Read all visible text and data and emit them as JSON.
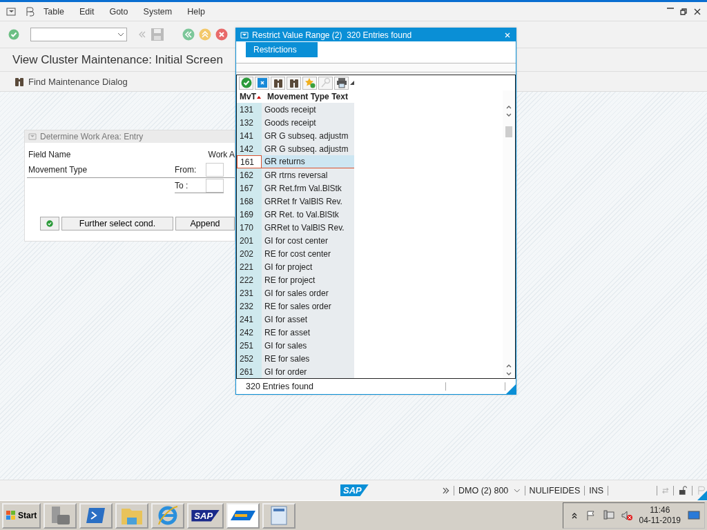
{
  "menu_bar": {
    "items": [
      {
        "label": "Table"
      },
      {
        "label": "Edit"
      },
      {
        "label": "Goto"
      },
      {
        "label": "System"
      },
      {
        "label": "Help"
      }
    ]
  },
  "screen_title": "View Cluster Maintenance: Initial Screen",
  "app_toolbar": {
    "buttons": [
      {
        "label": "Find Maintenance Dialog"
      }
    ]
  },
  "work_area_dialog": {
    "title": "Determine Work Area: Entry",
    "column_headers": [
      "Field Name",
      "Work A"
    ],
    "field": {
      "name": "Movement Type",
      "from_label": "From:",
      "to_label": "To :"
    },
    "buttons": [
      {
        "kind": "icon"
      },
      {
        "kind": "text",
        "label": "Further select cond."
      },
      {
        "kind": "text",
        "label": "Append"
      }
    ]
  },
  "popup": {
    "title": "Restrict Value Range (2)  320 Entries found",
    "tabs": [
      {
        "label": "Restrictions",
        "selected": true
      }
    ],
    "columns": [
      "MvT",
      "Movement Type Text"
    ],
    "rows": [
      {
        "code": "131",
        "text": "Goods receipt",
        "selected": false
      },
      {
        "code": "132",
        "text": "Goods receipt",
        "selected": false
      },
      {
        "code": "141",
        "text": "GR G subseq. adjustm",
        "selected": false
      },
      {
        "code": "142",
        "text": "GR G subseq. adjustm",
        "selected": false
      },
      {
        "code": "161",
        "text": "GR returns",
        "selected": true
      },
      {
        "code": "162",
        "text": "GR rtrns reversal",
        "selected": false
      },
      {
        "code": "167",
        "text": "GR Ret.frm Val.BlStk",
        "selected": false
      },
      {
        "code": "168",
        "text": "GRRet fr ValBlS Rev.",
        "selected": false
      },
      {
        "code": "169",
        "text": "GR Ret. to Val.BlStk",
        "selected": false
      },
      {
        "code": "170",
        "text": "GRRet to ValBlS Rev.",
        "selected": false
      },
      {
        "code": "201",
        "text": "GI for cost center",
        "selected": false
      },
      {
        "code": "202",
        "text": "RE for cost center",
        "selected": false
      },
      {
        "code": "221",
        "text": "GI for project",
        "selected": false
      },
      {
        "code": "222",
        "text": "RE for project",
        "selected": false
      },
      {
        "code": "231",
        "text": "GI for sales order",
        "selected": false
      },
      {
        "code": "232",
        "text": "RE for sales order",
        "selected": false
      },
      {
        "code": "241",
        "text": "GI for asset",
        "selected": false
      },
      {
        "code": "242",
        "text": "RE for asset",
        "selected": false
      },
      {
        "code": "251",
        "text": "GI for sales",
        "selected": false
      },
      {
        "code": "252",
        "text": "RE for sales",
        "selected": false
      },
      {
        "code": "261",
        "text": "GI for order",
        "selected": false
      }
    ],
    "footer": "320 Entries found"
  },
  "status_bar": {
    "logo": "SAP",
    "system": "DMO (2) 800",
    "user": "NULIFEIDES",
    "mode": "INS"
  },
  "taskbar": {
    "start": "Start",
    "apps": [
      {
        "kind": "tools",
        "selected": false
      },
      {
        "kind": "shell",
        "selected": false
      },
      {
        "kind": "folder",
        "selected": false
      },
      {
        "kind": "browser",
        "selected": false
      },
      {
        "kind": "logo",
        "label": "SAP",
        "selected": false
      },
      {
        "kind": "gui",
        "selected": true
      },
      {
        "kind": "editor",
        "selected": false
      }
    ],
    "clock": {
      "time": "11:46",
      "date": "04-11-2019"
    }
  }
}
